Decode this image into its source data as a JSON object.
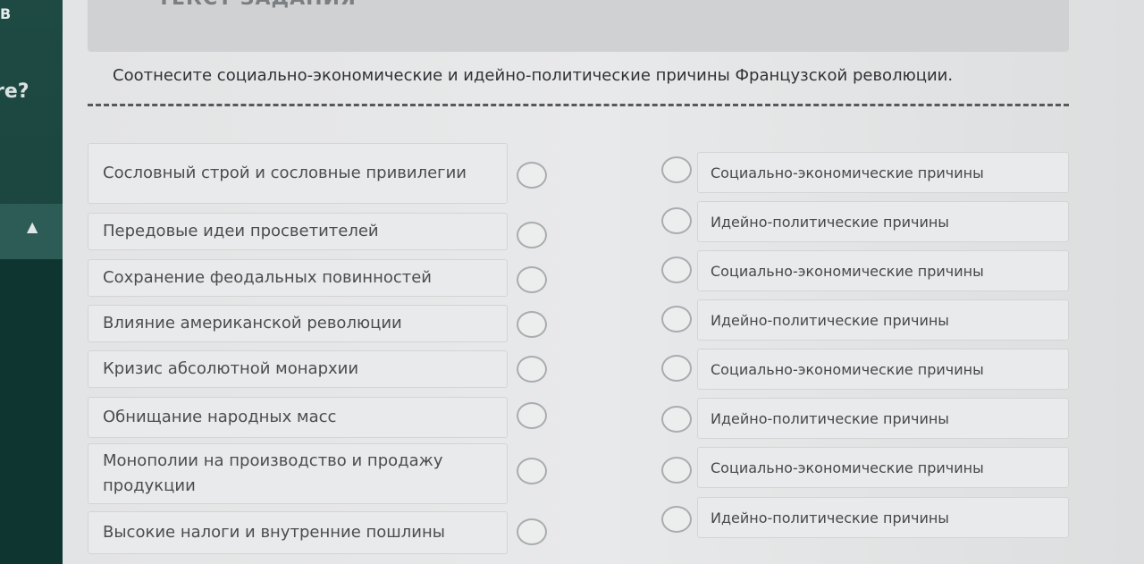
{
  "sidebar": {
    "top_label": "В",
    "question_fragment": "re?",
    "collapse_icon": "chevron-up-icon"
  },
  "header": {
    "title": "ТЕКСТ ЗАДАНИЯ"
  },
  "task": {
    "question": "Соотнесите социально-экономические и идейно-политические причины Французской революции."
  },
  "left_items": [
    "Сословный строй и сословные привилегии",
    "Передовые идеи просветителей",
    "Сохранение феодальных повинностей",
    "Влияние американской революции",
    "Кризис абсолютной монархии",
    "Обнищание народных масс",
    "Монополии на производство и продажу продукции",
    "Высокие налоги и внутренние пошлины"
  ],
  "right_items": [
    "Социально-экономические причины",
    "Идейно-политические причины",
    "Социально-экономические причины",
    "Идейно-политические причины",
    "Социально-экономические причины",
    "Идейно-политические причины",
    "Социально-экономические причины",
    "Идейно-политические причины"
  ]
}
